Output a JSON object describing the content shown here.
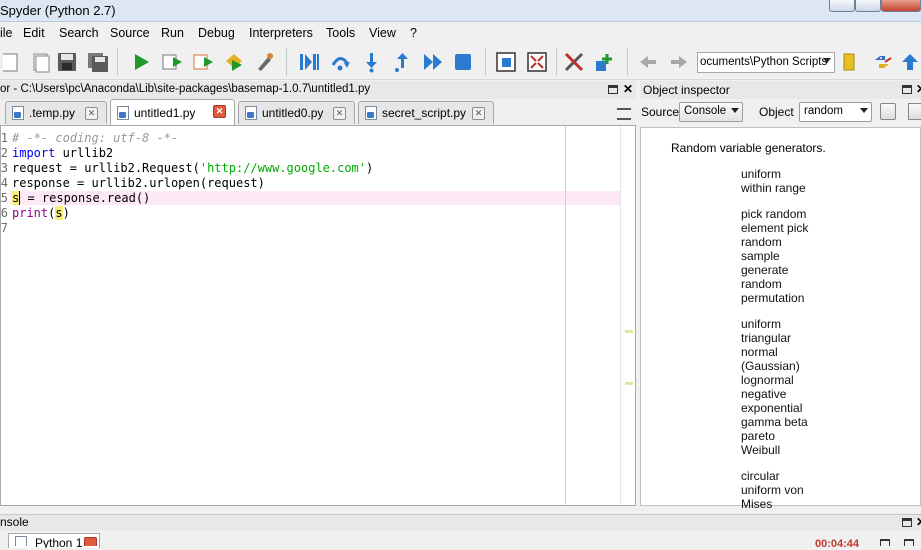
{
  "window": {
    "title": "Spyder (Python 2.7)"
  },
  "menu": [
    "ile",
    "Edit",
    "Search",
    "Source",
    "Run",
    "Debug",
    "Interpreters",
    "Tools",
    "View",
    "?"
  ],
  "toolbar": {
    "icons": [
      "new-file-icon",
      "open-file-icon",
      "save-icon",
      "save-all-icon",
      "run-icon",
      "run-config-icon",
      "run-again-icon",
      "debug-icon",
      "run-selection-icon",
      "run-cell-icon",
      "step-icon",
      "step-into-icon",
      "step-return-icon",
      "continue-icon",
      "stop-icon",
      "maximize-pane-icon",
      "fullscreen-icon",
      "preferences-icon",
      "pythonpath-icon",
      "back-icon",
      "forward-icon",
      "browse-folder-icon",
      "python-logo-icon",
      "up-icon"
    ],
    "path_value": "ocuments\\Python Scripts"
  },
  "editor": {
    "title": "or - C:\\Users\\pc\\Anaconda\\Lib\\site-packages\\basemap-1.0.7\\untitled1.py",
    "tabs": [
      {
        "label": ".temp.py",
        "active": false
      },
      {
        "label": "untitled1.py",
        "active": true
      },
      {
        "label": "untitled0.py",
        "active": false
      },
      {
        "label": "secret_script.py",
        "active": false
      }
    ],
    "line_numbers": [
      "1",
      "2",
      "3",
      "4",
      "5",
      "6",
      "7"
    ],
    "code": {
      "l1": "# -*- coding: utf-8 -*-",
      "l2_kw": "import",
      "l2_rest": " urllib2",
      "l3_a": "request = urllib2.Request(",
      "l3_str": "'http://www.google.com'",
      "l3_b": ")",
      "l4": "response = urllib2.urlopen(request)",
      "l5_cursor": "s",
      "l5_rest": " = response.read()",
      "l6_fn": "print",
      "l6_a": "(",
      "l6_arg": "s",
      "l6_b": ")"
    }
  },
  "object_inspector": {
    "title": "Object inspector",
    "source_label": "Source",
    "source_value": "Console",
    "object_label": "Object",
    "object_value": "random",
    "heading": "Random variable generators.",
    "groups": [
      [
        "uniform",
        "within range"
      ],
      [
        "pick random",
        "element pick",
        "random",
        "sample",
        "generate",
        "random",
        "permutation"
      ],
      [
        "uniform",
        "triangular",
        "normal",
        "(Gaussian)",
        "lognormal",
        "negative",
        "exponential",
        "gamma beta",
        "pareto",
        "Weibull"
      ],
      [
        "circular",
        "uniform von",
        "Mises"
      ]
    ]
  },
  "console": {
    "title": "nsole",
    "tab_label": "Python 1",
    "time": "00:04:44"
  },
  "colors": {
    "keyword": "#0000ff",
    "string": "#00aa00",
    "builtin": "#900090",
    "comment": "#999999",
    "current_line": "#fde8f6",
    "highlight": "#f6f07a"
  }
}
